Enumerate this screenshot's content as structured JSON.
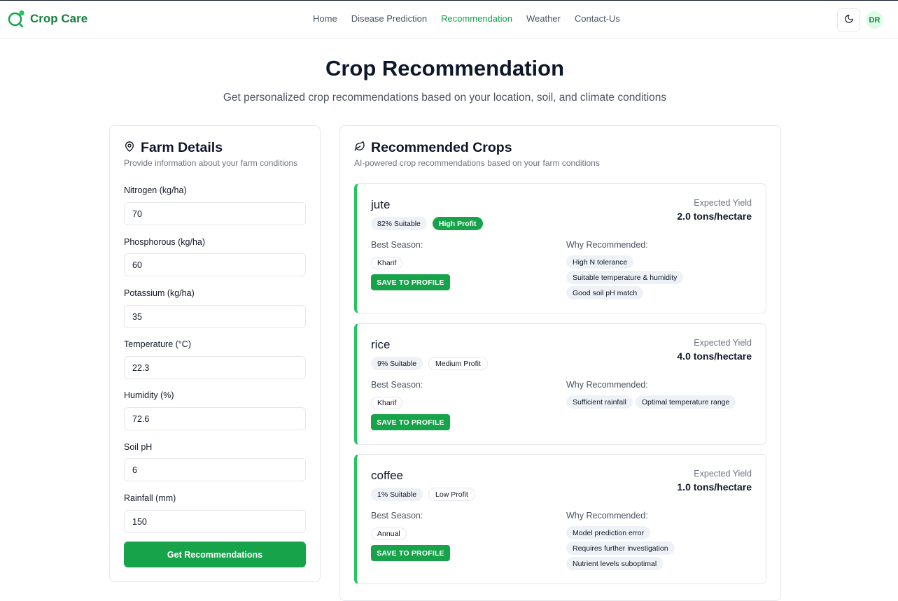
{
  "brand": {
    "name": "Crop Care",
    "accent": "#16a34a"
  },
  "nav": {
    "items": [
      "Home",
      "Disease Prediction",
      "Recommendation",
      "Weather",
      "Contact-Us"
    ],
    "active": "Recommendation"
  },
  "user": {
    "initials": "DR"
  },
  "hero": {
    "title": "Crop Recommendation",
    "subtitle": "Get personalized crop recommendations based on your location, soil, and climate conditions"
  },
  "farm": {
    "title": "Farm Details",
    "description": "Provide information about your farm conditions",
    "fields": [
      {
        "label": "Nitrogen (kg/ha)",
        "value": "70"
      },
      {
        "label": "Phosphorous (kg/ha)",
        "value": "60"
      },
      {
        "label": "Potassium (kg/ha)",
        "value": "35"
      },
      {
        "label": "Temperature (°C)",
        "value": "22.3"
      },
      {
        "label": "Humidity (%)",
        "value": "72.6"
      },
      {
        "label": "Soil pH",
        "value": "6"
      },
      {
        "label": "Rainfall (mm)",
        "value": "150"
      }
    ],
    "submit_label": "Get Recommendations"
  },
  "recommendations": {
    "title": "Recommended Crops",
    "description": "AI-powered crop recommendations based on your farm conditions",
    "yield_label": "Expected Yield",
    "season_label": "Best Season:",
    "why_label": "Why Recommended:",
    "save_label": "SAVE TO PROFILE",
    "crops": [
      {
        "name": "jute",
        "suitability": "82% Suitable",
        "profit": "High Profit",
        "yield": "2.0 tons/hectare",
        "season": "Kharif",
        "reasons": [
          "High N tolerance",
          "Suitable temperature & humidity",
          "Good soil pH match"
        ]
      },
      {
        "name": "rice",
        "suitability": "9% Suitable",
        "profit": "Medium Profit",
        "yield": "4.0 tons/hectare",
        "season": "Kharif",
        "reasons": [
          "Sufficient rainfall",
          "Optimal temperature range"
        ]
      },
      {
        "name": "coffee",
        "suitability": "1% Suitable",
        "profit": "Low Profit",
        "yield": "1.0 tons/hectare",
        "season": "Annual",
        "reasons": [
          "Model prediction error",
          "Requires further investigation",
          "Nutrient levels suboptimal"
        ]
      }
    ]
  }
}
